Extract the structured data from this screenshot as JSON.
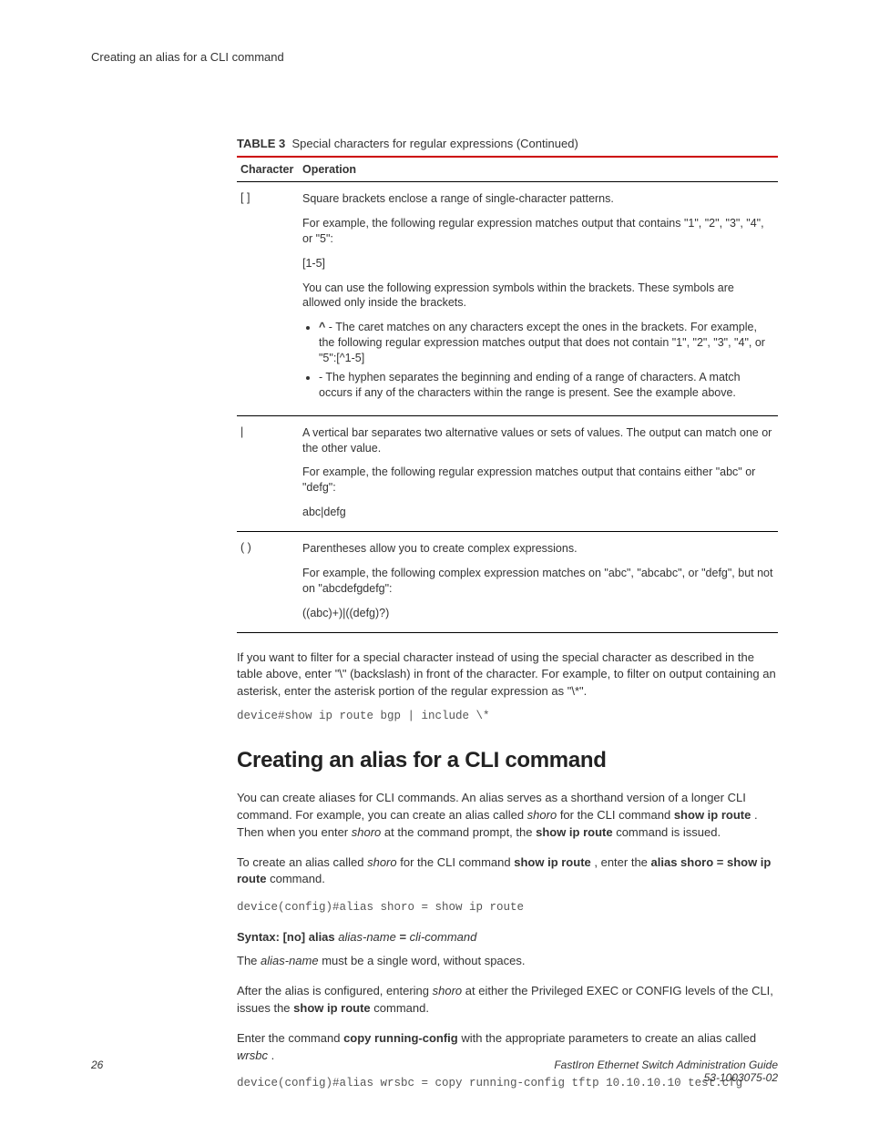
{
  "running_header": "Creating an alias for a CLI command",
  "table": {
    "label": "TABLE 3",
    "caption": "Special characters for regular expressions (Continued)",
    "head": {
      "c1": "Character",
      "c2": "Operation"
    },
    "rows": [
      {
        "char": "[ ]",
        "p1": "Square brackets enclose a range of single-character patterns.",
        "p2": "For example, the following regular expression matches output that contains \"1\", \"2\", \"3\", \"4\", or \"5\":",
        "p3": "[1-5]",
        "p4": "You can use the following expression symbols within the brackets. These symbols are allowed only inside the brackets.",
        "li1a": "^",
        "li1b": " - The caret matches on any characters except the ones in the brackets. For example, the following regular expression matches output that does not contain \"1\", \"2\", \"3\", \"4\", or \"5\":[^1-5]",
        "li2": "- The hyphen separates the beginning and ending of a range of characters. A match occurs if any of the characters within the range is present. See the example above."
      },
      {
        "char": "|",
        "p1": "A vertical bar separates two alternative values or sets of values. The output can match one or the other value.",
        "p2": "For example, the following regular expression matches output that contains either \"abc\" or \"defg\":",
        "p3": "abc|defg"
      },
      {
        "char": "( )",
        "p1": "Parentheses allow you to create complex expressions.",
        "p2": "For example, the following complex expression matches on \"abc\", \"abcabc\", or \"defg\", but not on \"abcdefgdefg\":",
        "p3": "((abc)+)|((defg)?)"
      }
    ]
  },
  "after_table_para": "If you want to filter for a special character instead of using the special character as described in the table above, enter \"\\\" (backslash) in front of the character. For example, to filter on output containing an asterisk, enter the asterisk portion of the regular expression as \"\\*\".",
  "code1": "device#show ip route bgp | include \\*",
  "section_title": "Creating an alias for a CLI command",
  "p1a": "You can create aliases for CLI commands. An alias serves as a shorthand version of a longer CLI command. For example, you can create an alias called ",
  "p1b": "shoro",
  "p1c": " for the CLI command ",
  "p1d": "show ip route",
  "p1e": " . Then when you enter ",
  "p1f": "shoro",
  "p1g": " at the command prompt, the ",
  "p1h": "show ip route",
  "p1i": " command is issued.",
  "p2a": "To create an alias called ",
  "p2b": "shoro",
  "p2c": " for the CLI command ",
  "p2d": "show ip route",
  "p2e": " , enter the ",
  "p2f": "alias shoro = show ip route",
  "p2g": " command.",
  "code2": "device(config)#alias shoro = show ip route",
  "syntax": {
    "a": "Syntax: [no] alias ",
    "b": "alias-name",
    "c": " = ",
    "d": "cli-command"
  },
  "p3a": "The ",
  "p3b": "alias-name",
  "p3c": " must be a single word, without spaces.",
  "p4a": "After the alias is configured, entering ",
  "p4b": "shoro",
  "p4c": " at either the Privileged EXEC or CONFIG levels of the CLI, issues the ",
  "p4d": "show ip route",
  "p4e": " command.",
  "p5a": "Enter the command ",
  "p5b": "copy running-config",
  "p5c": " with the appropriate parameters to create an alias called ",
  "p5d": "wrsbc",
  "p5e": " .",
  "code3": "device(config)#alias wrsbc = copy running-config tftp 10.10.10.10 test.cfg",
  "footer": {
    "page": "26",
    "title": "FastIron Ethernet Switch Administration Guide",
    "docnum": "53-1003075-02"
  }
}
